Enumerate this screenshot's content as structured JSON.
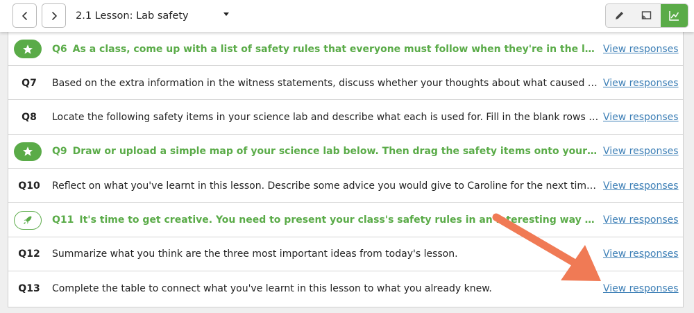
{
  "header": {
    "lesson_title": "2.1 Lesson: Lab safety",
    "back_icon": "chevron-left-icon",
    "forward_icon": "chevron-right-icon",
    "modes": [
      {
        "icon": "pencil-icon",
        "active": false
      },
      {
        "icon": "present-icon",
        "active": false
      },
      {
        "icon": "chart-icon",
        "active": true
      }
    ]
  },
  "colors": {
    "accent": "#5aab48",
    "link": "#3d7fb6",
    "annotation_arrow": "#f07a55"
  },
  "questions": [
    {
      "id": "Q6",
      "badge": "star",
      "highlight": true,
      "text": "As a class, come up with a list of safety rules that everyone must follow when they're in the lab. Upload a photo …",
      "action": "View responses"
    },
    {
      "id": "Q7",
      "badge": "",
      "highlight": false,
      "text": "Based on the extra information in the witness statements, discuss whether your thoughts about what caused the accide…",
      "action": "View responses"
    },
    {
      "id": "Q8",
      "badge": "",
      "highlight": false,
      "text": "Locate the following safety items in your science lab and describe what each is used for. Fill in the blank rows with any o…",
      "action": "View responses"
    },
    {
      "id": "Q9",
      "badge": "star",
      "highlight": true,
      "text": "Draw or upload a simple map of your science lab below. Then drag the safety items onto your map to illustrate …",
      "action": "View responses"
    },
    {
      "id": "Q10",
      "badge": "",
      "highlight": false,
      "text": "Reflect on what you've learnt in this lesson. Describe some advice you would give to Caroline for the next time she's in t…",
      "action": "View responses"
    },
    {
      "id": "Q11",
      "badge": "rocket",
      "highlight": true,
      "text": "It's time to get creative. You need to present your class's safety rules in an interesting way to help your class r…",
      "action": "View responses"
    },
    {
      "id": "Q12",
      "badge": "",
      "highlight": false,
      "text": "Summarize what you think are the three most important ideas from today's lesson.",
      "action": "View responses"
    },
    {
      "id": "Q13",
      "badge": "",
      "highlight": false,
      "text": "Complete the table to connect what you've learnt in this lesson to what you already knew.",
      "action": "View responses"
    }
  ]
}
